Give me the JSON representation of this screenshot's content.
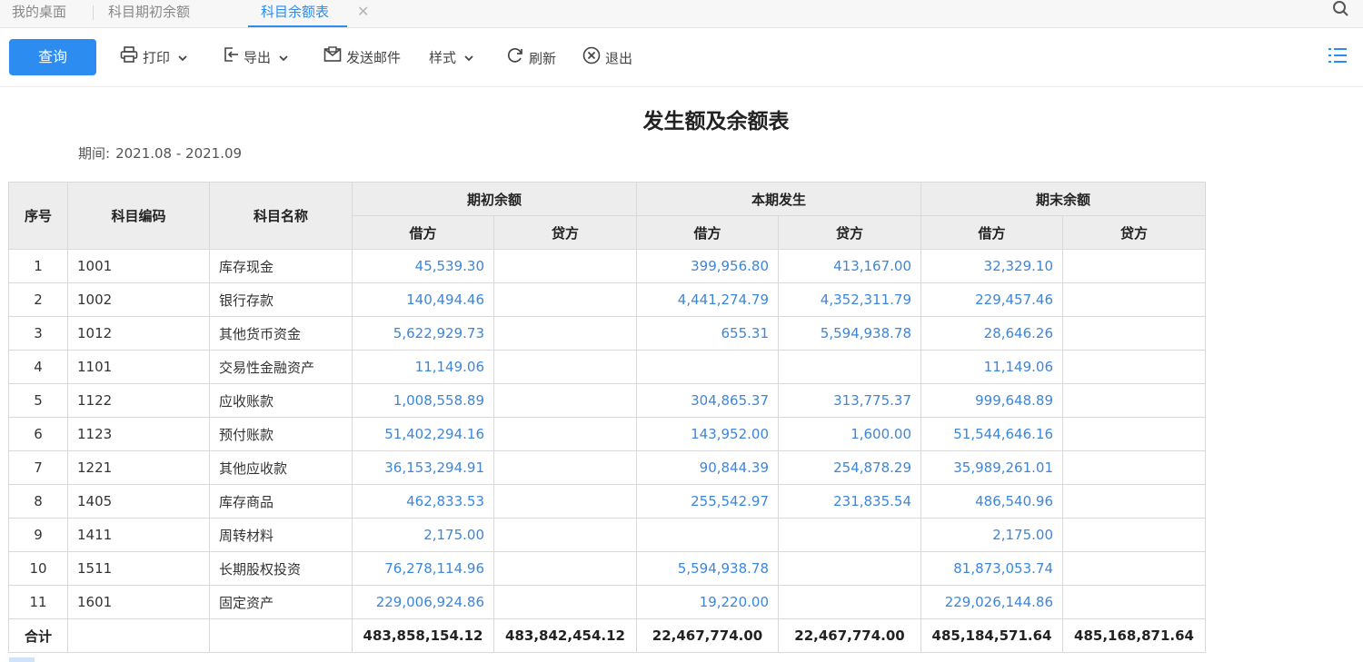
{
  "tabs": [
    {
      "label": "我的桌面"
    },
    {
      "label": "科目期初余额"
    },
    {
      "label": "科目余额表"
    }
  ],
  "toolbar": {
    "query": "查询",
    "print": "打印",
    "export": "导出",
    "email": "发送邮件",
    "style": "样式",
    "refresh": "刷新",
    "exit": "退出"
  },
  "report": {
    "title": "发生额及余额表",
    "period_label": "期间:",
    "period_value": "2021.08 - 2021.09"
  },
  "table": {
    "headers": {
      "seq": "序号",
      "code": "科目编码",
      "name": "科目名称",
      "opening": "期初余额",
      "current": "本期发生",
      "closing": "期末余额",
      "debit": "借方",
      "credit": "贷方"
    },
    "rows": [
      {
        "seq": "1",
        "code": "1001",
        "name": "库存现金",
        "od": "45,539.30",
        "oc": "",
        "cd": "399,956.80",
        "cc": "413,167.00",
        "ed": "32,329.10",
        "ec": ""
      },
      {
        "seq": "2",
        "code": "1002",
        "name": "银行存款",
        "od": "140,494.46",
        "oc": "",
        "cd": "4,441,274.79",
        "cc": "4,352,311.79",
        "ed": "229,457.46",
        "ec": ""
      },
      {
        "seq": "3",
        "code": "1012",
        "name": "其他货币资金",
        "od": "5,622,929.73",
        "oc": "",
        "cd": "655.31",
        "cc": "5,594,938.78",
        "ed": "28,646.26",
        "ec": ""
      },
      {
        "seq": "4",
        "code": "1101",
        "name": "交易性金融资产",
        "od": "11,149.06",
        "oc": "",
        "cd": "",
        "cc": "",
        "ed": "11,149.06",
        "ec": ""
      },
      {
        "seq": "5",
        "code": "1122",
        "name": "应收账款",
        "od": "1,008,558.89",
        "oc": "",
        "cd": "304,865.37",
        "cc": "313,775.37",
        "ed": "999,648.89",
        "ec": ""
      },
      {
        "seq": "6",
        "code": "1123",
        "name": "预付账款",
        "od": "51,402,294.16",
        "oc": "",
        "cd": "143,952.00",
        "cc": "1,600.00",
        "ed": "51,544,646.16",
        "ec": ""
      },
      {
        "seq": "7",
        "code": "1221",
        "name": "其他应收款",
        "od": "36,153,294.91",
        "oc": "",
        "cd": "90,844.39",
        "cc": "254,878.29",
        "ed": "35,989,261.01",
        "ec": ""
      },
      {
        "seq": "8",
        "code": "1405",
        "name": "库存商品",
        "od": "462,833.53",
        "oc": "",
        "cd": "255,542.97",
        "cc": "231,835.54",
        "ed": "486,540.96",
        "ec": ""
      },
      {
        "seq": "9",
        "code": "1411",
        "name": "周转材料",
        "od": "2,175.00",
        "oc": "",
        "cd": "",
        "cc": "",
        "ed": "2,175.00",
        "ec": ""
      },
      {
        "seq": "10",
        "code": "1511",
        "name": "长期股权投资",
        "od": "76,278,114.96",
        "oc": "",
        "cd": "5,594,938.78",
        "cc": "",
        "ed": "81,873,053.74",
        "ec": ""
      },
      {
        "seq": "11",
        "code": "1601",
        "name": "固定资产",
        "od": "229,006,924.86",
        "oc": "",
        "cd": "19,220.00",
        "cc": "",
        "ed": "229,026,144.86",
        "ec": ""
      }
    ],
    "total": {
      "label": "合计",
      "od": "483,858,154.12",
      "oc": "483,842,454.12",
      "cd": "22,467,774.00",
      "cc": "22,467,774.00",
      "ed": "485,184,571.64",
      "ec": "485,168,871.64"
    }
  },
  "colors": {
    "accent": "#2d8cf0",
    "value_text": "#3d86d9"
  }
}
